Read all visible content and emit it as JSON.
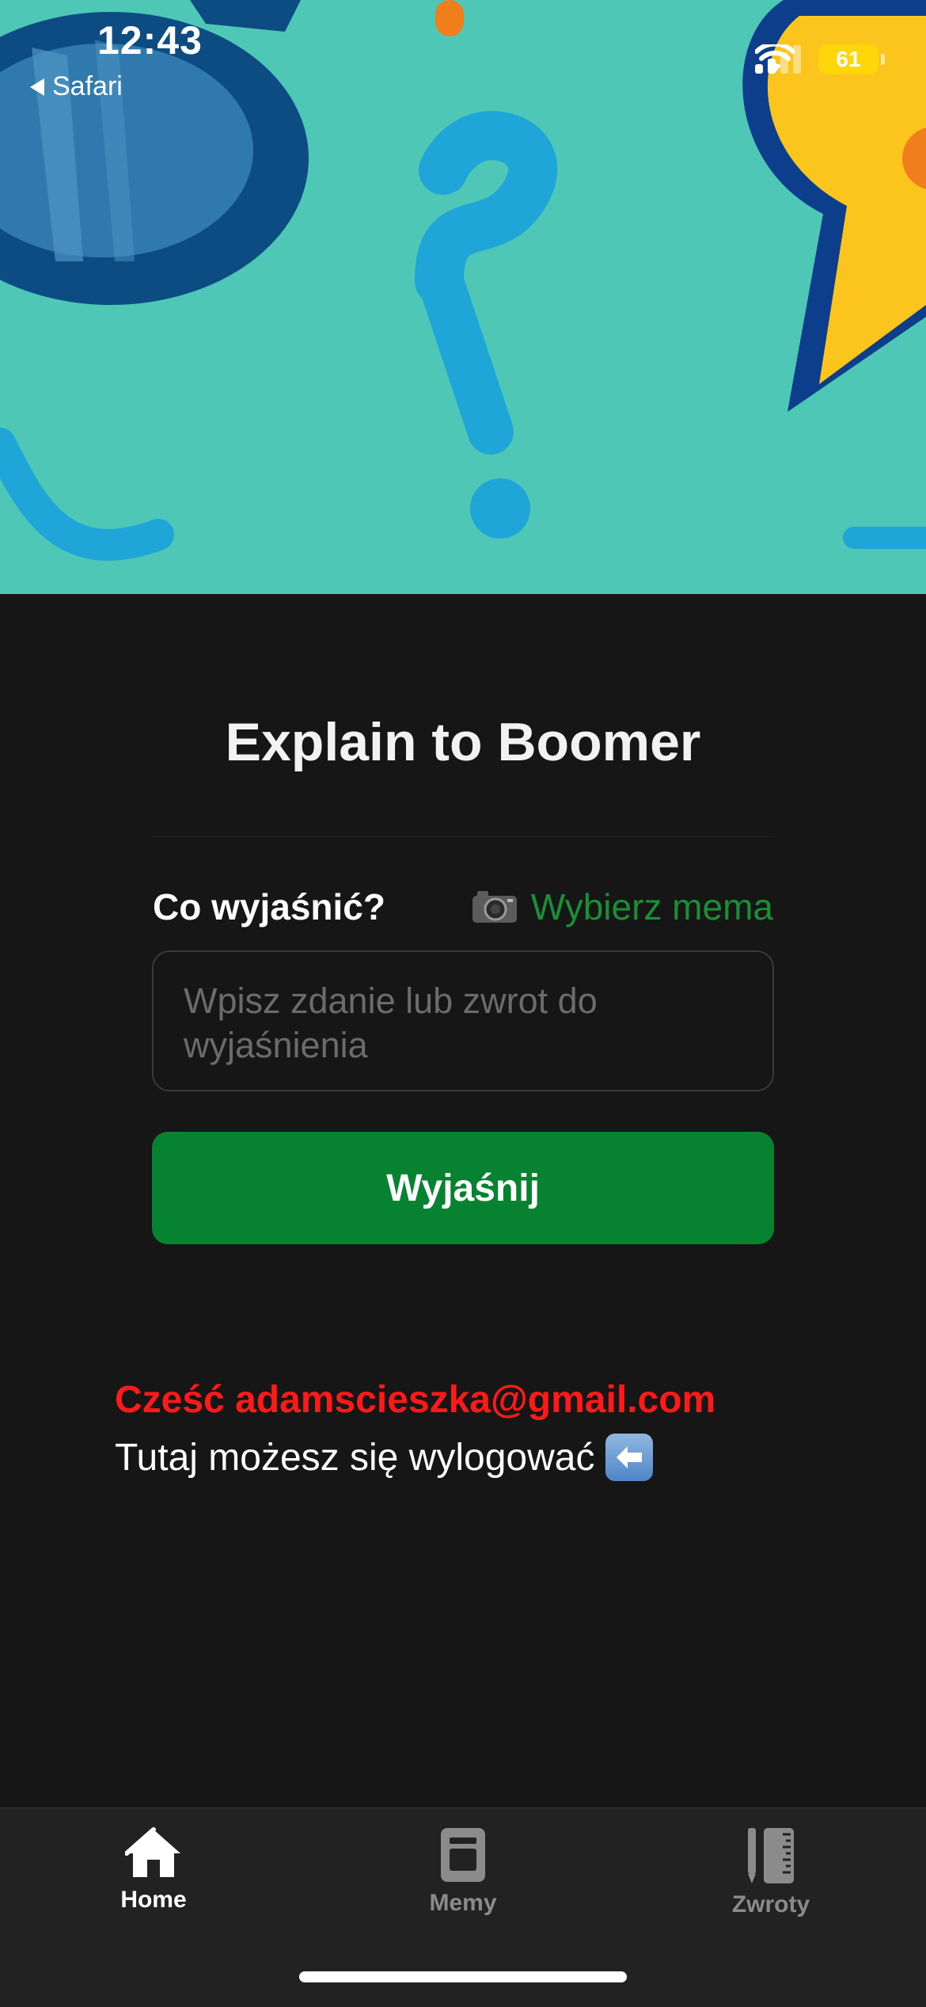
{
  "status_bar": {
    "time": "12:43",
    "back_label": "Safari",
    "battery": "61"
  },
  "hero": {
    "illustration": "question-mark-and-speech-bubble-illustration"
  },
  "main": {
    "title": "Explain to Boomer",
    "question_label": "Co wyjaśnić?",
    "meme_link_label": "Wybierz mema",
    "input_placeholder": "Wpisz zdanie lub zwrot do wyjaśnienia",
    "input_value": "",
    "explain_button_label": "Wyjaśnij"
  },
  "account": {
    "greeting": "Cześć adamscieszka@gmail.com",
    "logout_text": "Tutaj możesz się wylogować"
  },
  "tabbar": {
    "tabs": [
      {
        "label": "Home",
        "icon": "home-icon",
        "active": true
      },
      {
        "label": "Memy",
        "icon": "memes-icon",
        "active": false
      },
      {
        "label": "Zwroty",
        "icon": "phrases-icon",
        "active": false
      }
    ]
  },
  "colors": {
    "background": "#161616",
    "accent_green": "#068231",
    "link_green": "#1b8f36",
    "greeting_red": "#ff1a1a",
    "hero_teal": "#4ec7b7"
  }
}
